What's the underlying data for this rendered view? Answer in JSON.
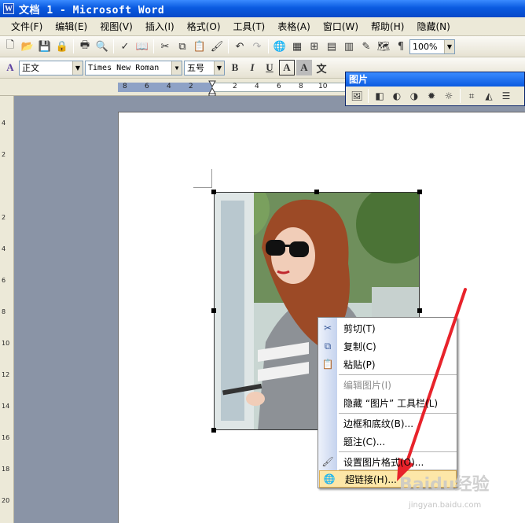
{
  "window": {
    "title": "文档 1 - Microsoft Word",
    "app_icon": "W"
  },
  "menu": [
    "文件(F)",
    "编辑(E)",
    "视图(V)",
    "插入(I)",
    "格式(O)",
    "工具(T)",
    "表格(A)",
    "窗口(W)",
    "帮助(H)",
    "隐藏(N)"
  ],
  "standard_toolbar": {
    "zoom": "100%"
  },
  "format_toolbar": {
    "style": "正文",
    "font": "Times New Roman",
    "size": "五号",
    "bold": "B",
    "italic": "I",
    "underline": "U",
    "char_border": "A",
    "char_shade": "A"
  },
  "ruler": {
    "h_ticks": [
      "8",
      "6",
      "4",
      "2",
      "2",
      "4",
      "6",
      "8",
      "10"
    ],
    "v_ticks": [
      "4",
      "2",
      "2",
      "4",
      "6",
      "8",
      "10",
      "12",
      "14",
      "16",
      "18",
      "20"
    ]
  },
  "picture_toolbar": {
    "title": "图片"
  },
  "context_menu": {
    "items": [
      {
        "label": "剪切(T)",
        "icon": "scissors-icon",
        "enabled": true
      },
      {
        "label": "复制(C)",
        "icon": "copy-icon",
        "enabled": true
      },
      {
        "label": "粘贴(P)",
        "icon": "paste-icon",
        "enabled": true
      },
      {
        "label": "编辑图片(I)",
        "icon": "",
        "enabled": false
      },
      {
        "label": "隐藏 “图片” 工具栏(L)",
        "icon": "",
        "enabled": true
      },
      {
        "label": "边框和底纹(B)...",
        "icon": "",
        "enabled": true
      },
      {
        "label": "题注(C)...",
        "icon": "",
        "enabled": true
      },
      {
        "label": "设置图片格式(O)...",
        "icon": "format-picture-icon",
        "enabled": true
      },
      {
        "label": "超链接(H)...",
        "icon": "hyperlink-icon",
        "enabled": true,
        "highlighted": true
      }
    ]
  },
  "watermark": {
    "brand": "Baidu经验",
    "url": "jingyan.baidu.com"
  },
  "colors": {
    "title_bar": "#0a5ae0",
    "menu_bg": "#ece9d8",
    "highlight": "#fde7a8",
    "arrow": "#e8232b"
  }
}
